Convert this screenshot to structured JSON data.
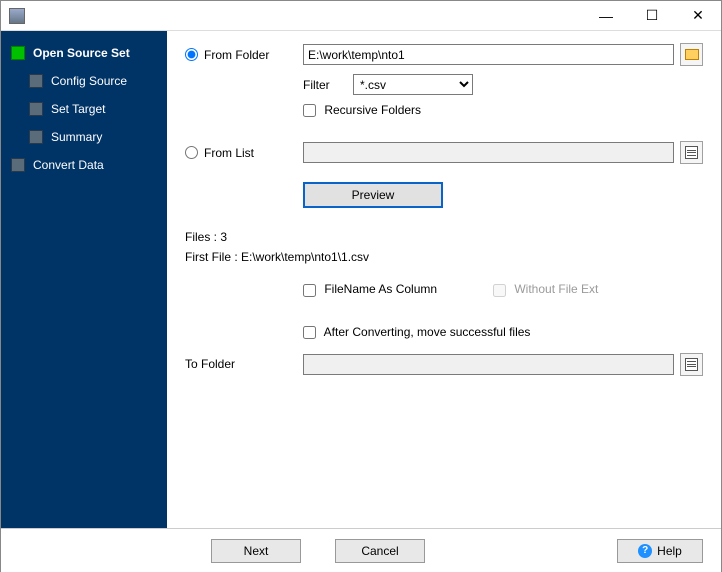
{
  "window": {
    "minimize": "—",
    "maximize": "☐",
    "close": "✕"
  },
  "sidebar": {
    "items": [
      {
        "label": "Open Source Set",
        "active": true,
        "sub": false
      },
      {
        "label": "Config Source",
        "active": false,
        "sub": true
      },
      {
        "label": "Set Target",
        "active": false,
        "sub": true
      },
      {
        "label": "Summary",
        "active": false,
        "sub": true
      },
      {
        "label": "Convert Data",
        "active": false,
        "sub": false
      }
    ]
  },
  "main": {
    "from_folder_label": "From Folder",
    "from_folder_value": "E:\\work\\temp\\nto1",
    "filter_label": "Filter",
    "filter_value": "*.csv",
    "recursive_label": "Recursive Folders",
    "recursive_checked": false,
    "from_list_label": "From List",
    "from_list_value": "",
    "preview_label": "Preview",
    "files_count_label": "Files : 3",
    "first_file_label": "First File : E:\\work\\temp\\nto1\\1.csv",
    "filename_as_column_label": "FileName As Column",
    "filename_as_column_checked": false,
    "without_ext_label": "Without File Ext",
    "without_ext_checked": false,
    "after_convert_label": "After Converting, move successful files",
    "after_convert_checked": false,
    "to_folder_label": "To Folder",
    "to_folder_value": ""
  },
  "footer": {
    "next": "Next",
    "cancel": "Cancel",
    "help": "Help"
  }
}
